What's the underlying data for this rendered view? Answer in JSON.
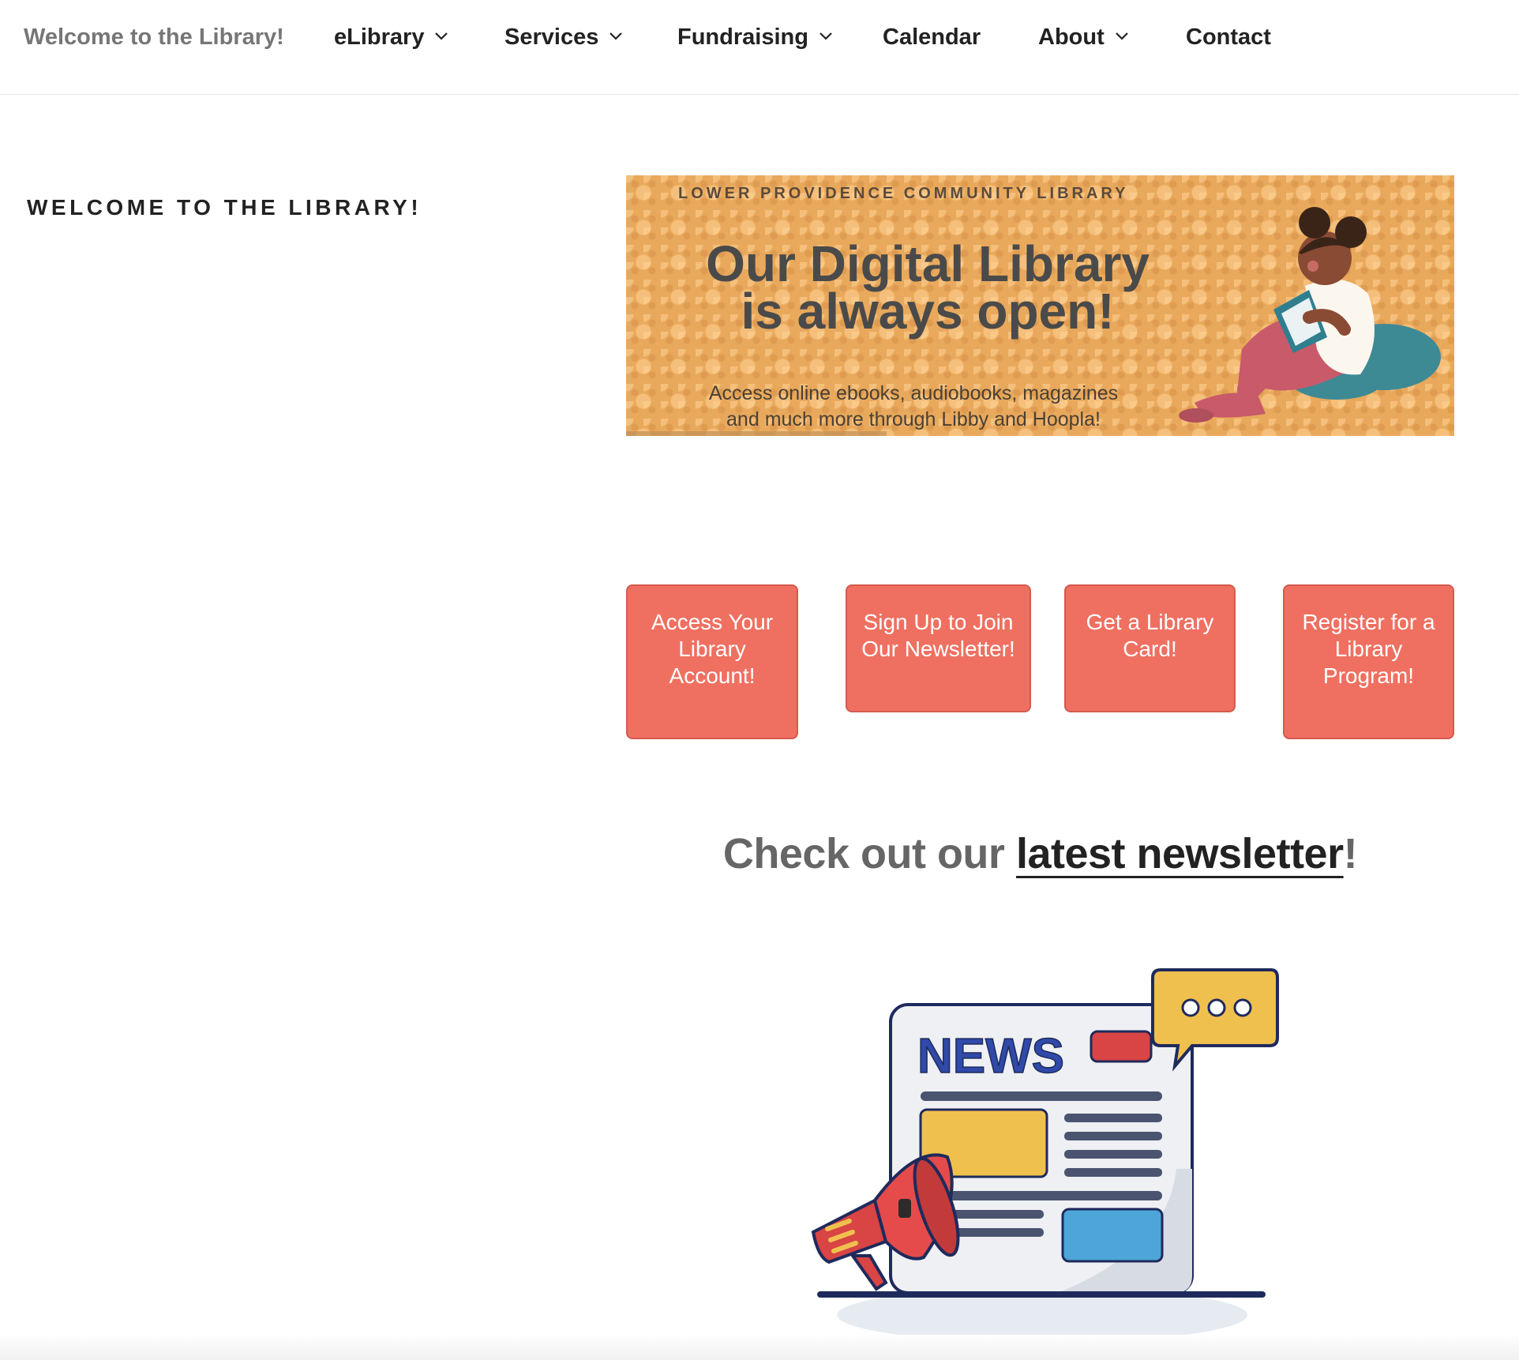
{
  "header": {
    "site_title": "Welcome to the Library!",
    "nav": [
      {
        "label": "eLibrary",
        "has_dropdown": true
      },
      {
        "label": "Services",
        "has_dropdown": true
      },
      {
        "label": "Fundraising",
        "has_dropdown": true
      },
      {
        "label": "Calendar",
        "has_dropdown": false
      },
      {
        "label": "About",
        "has_dropdown": true
      },
      {
        "label": "Contact",
        "has_dropdown": false
      }
    ]
  },
  "sidebar": {
    "widget_title": "Welcome to the Library!"
  },
  "banner": {
    "org": "LOWER PROVIDENCE COMMUNITY LIBRARY",
    "headline_line1": "Our Digital Library",
    "headline_line2": "is always open!",
    "sub_line1": "Access online ebooks, audiobooks, magazines",
    "sub_line2": "and much more through Libby and Hoopla!"
  },
  "cta_buttons": [
    {
      "label": "Access Your Library Account!"
    },
    {
      "label": "Sign Up to Join Our Newsletter!"
    },
    {
      "label": "Get a Library Card!"
    },
    {
      "label": "Register for a Library Program!"
    }
  ],
  "promo": {
    "prefix": "Check out our ",
    "link_text": "latest newsletter",
    "suffix": "!"
  },
  "news_illustration": {
    "word": "NEWS"
  },
  "colors": {
    "cta_background": "#ef7061",
    "banner_background": "#e9a95c",
    "site_title": "#767676",
    "news_blue": "#2f4aa8"
  }
}
